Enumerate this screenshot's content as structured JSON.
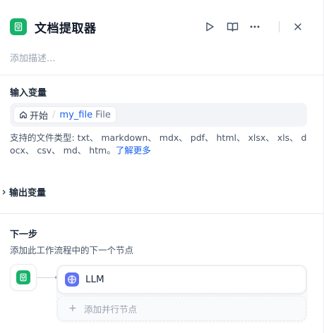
{
  "header": {
    "title": "文档提取器",
    "icon": "document-extractor-icon",
    "accent": "#17b26a"
  },
  "description_placeholder": "添加描述...",
  "input_section": {
    "title": "输入变量",
    "source_label": "开始",
    "separator": "/",
    "variable_name": "my_file",
    "variable_type": "File",
    "support_text": "支持的文件类型: txt、 markdown、 mdx、 pdf、 html、 xlsx、 xls、 docx、 csv、 md、 htm。",
    "learn_more": "了解更多"
  },
  "output_section": {
    "title": "输出变量"
  },
  "next_step": {
    "title": "下一步",
    "description": "添加此工作流程中的下一个节点",
    "next_node_label": "LLM",
    "next_node_color": "#6172f3",
    "add_parallel_label": "添加并行节点"
  }
}
